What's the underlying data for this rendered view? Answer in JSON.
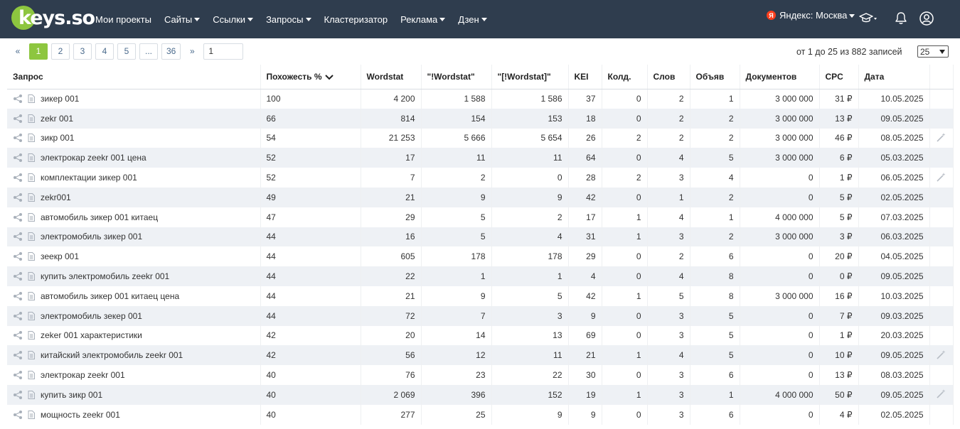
{
  "nav": {
    "logo": "keys.so",
    "items": [
      {
        "label": "Мои проекты",
        "dropdown": false
      },
      {
        "label": "Сайты",
        "dropdown": true
      },
      {
        "label": "Ссылки",
        "dropdown": true
      },
      {
        "label": "Запросы",
        "dropdown": true
      },
      {
        "label": "Кластеризатор",
        "dropdown": false
      },
      {
        "label": "Реклама",
        "dropdown": true
      },
      {
        "label": "Дзен",
        "dropdown": true
      }
    ],
    "region_badge": "Я",
    "region": "Яндекс: Москва"
  },
  "pagination": {
    "prev": "«",
    "pages": [
      "1",
      "2",
      "3",
      "4",
      "5",
      "...",
      "36"
    ],
    "active_page": "1",
    "next": "»",
    "goto_value": "1"
  },
  "records_info": "от 1 до 25 из 882 записей",
  "per_page": "25",
  "colors": {
    "header_bg": "#2f3d4e",
    "accent": "#8dc63f",
    "row_alt": "#eef1f5"
  },
  "table": {
    "columns": [
      "Запрос",
      "Похожесть %",
      "Wordstat",
      "\"!Wordstat\"",
      "\"[!Wordstat]\"",
      "KEI",
      "Колд.",
      "Слов",
      "Объяв",
      "Документов",
      "CPC",
      "Дата"
    ],
    "sorted_column": "Похожесть %",
    "rows": [
      {
        "query": "зикер 001",
        "sim": "100",
        "ws": "4 200",
        "ws_excl": "1 588",
        "ws_exact": "1 586",
        "kei": "37",
        "kold": "0",
        "words": "2",
        "ads": "1",
        "docs": "3 000 000",
        "cpc": "31 ₽",
        "date": "10.05.2025",
        "wand": false
      },
      {
        "query": "zekr 001",
        "sim": "66",
        "ws": "814",
        "ws_excl": "154",
        "ws_exact": "153",
        "kei": "18",
        "kold": "0",
        "words": "2",
        "ads": "2",
        "docs": "3 000 000",
        "cpc": "13 ₽",
        "date": "09.05.2025",
        "wand": false
      },
      {
        "query": "зикр 001",
        "sim": "54",
        "ws": "21 253",
        "ws_excl": "5 666",
        "ws_exact": "5 654",
        "kei": "26",
        "kold": "2",
        "words": "2",
        "ads": "2",
        "docs": "3 000 000",
        "cpc": "46 ₽",
        "date": "08.05.2025",
        "wand": true
      },
      {
        "query": "электрокар zeekr 001 цена",
        "sim": "52",
        "ws": "17",
        "ws_excl": "11",
        "ws_exact": "11",
        "kei": "64",
        "kold": "0",
        "words": "4",
        "ads": "5",
        "docs": "3 000 000",
        "cpc": "6 ₽",
        "date": "05.03.2025",
        "wand": false
      },
      {
        "query": "комплектации зикер 001",
        "sim": "52",
        "ws": "7",
        "ws_excl": "2",
        "ws_exact": "0",
        "kei": "28",
        "kold": "2",
        "words": "3",
        "ads": "4",
        "docs": "0",
        "cpc": "1 ₽",
        "date": "06.05.2025",
        "wand": true
      },
      {
        "query": "zekr001",
        "sim": "49",
        "ws": "21",
        "ws_excl": "9",
        "ws_exact": "9",
        "kei": "42",
        "kold": "0",
        "words": "1",
        "ads": "2",
        "docs": "0",
        "cpc": "5 ₽",
        "date": "02.05.2025",
        "wand": false
      },
      {
        "query": "автомобиль зикер 001 китаец",
        "sim": "47",
        "ws": "29",
        "ws_excl": "5",
        "ws_exact": "2",
        "kei": "17",
        "kold": "1",
        "words": "4",
        "ads": "1",
        "docs": "4 000 000",
        "cpc": "5 ₽",
        "date": "07.03.2025",
        "wand": false
      },
      {
        "query": "электромобиль зикер 001",
        "sim": "44",
        "ws": "16",
        "ws_excl": "5",
        "ws_exact": "4",
        "kei": "31",
        "kold": "1",
        "words": "3",
        "ads": "2",
        "docs": "3 000 000",
        "cpc": "3 ₽",
        "date": "06.03.2025",
        "wand": false
      },
      {
        "query": "зеекр 001",
        "sim": "44",
        "ws": "605",
        "ws_excl": "178",
        "ws_exact": "178",
        "kei": "29",
        "kold": "0",
        "words": "2",
        "ads": "6",
        "docs": "0",
        "cpc": "20 ₽",
        "date": "04.05.2025",
        "wand": false
      },
      {
        "query": "купить электромобиль zeekr 001",
        "sim": "44",
        "ws": "22",
        "ws_excl": "1",
        "ws_exact": "1",
        "kei": "4",
        "kold": "0",
        "words": "4",
        "ads": "8",
        "docs": "0",
        "cpc": "0 ₽",
        "date": "09.05.2025",
        "wand": false
      },
      {
        "query": "автомобиль зикер 001 китаец цена",
        "sim": "44",
        "ws": "21",
        "ws_excl": "9",
        "ws_exact": "5",
        "kei": "42",
        "kold": "1",
        "words": "5",
        "ads": "8",
        "docs": "3 000 000",
        "cpc": "16 ₽",
        "date": "10.03.2025",
        "wand": false
      },
      {
        "query": "электромобиль зекер 001",
        "sim": "44",
        "ws": "72",
        "ws_excl": "7",
        "ws_exact": "3",
        "kei": "9",
        "kold": "0",
        "words": "3",
        "ads": "5",
        "docs": "0",
        "cpc": "7 ₽",
        "date": "09.03.2025",
        "wand": false
      },
      {
        "query": "zeker 001 характеристики",
        "sim": "42",
        "ws": "20",
        "ws_excl": "14",
        "ws_exact": "13",
        "kei": "69",
        "kold": "0",
        "words": "3",
        "ads": "5",
        "docs": "0",
        "cpc": "1 ₽",
        "date": "20.03.2025",
        "wand": false
      },
      {
        "query": "китайский электромобиль zeekr 001",
        "sim": "42",
        "ws": "56",
        "ws_excl": "12",
        "ws_exact": "11",
        "kei": "21",
        "kold": "1",
        "words": "4",
        "ads": "5",
        "docs": "0",
        "cpc": "10 ₽",
        "date": "09.05.2025",
        "wand": true
      },
      {
        "query": "электрокар zeekr 001",
        "sim": "40",
        "ws": "76",
        "ws_excl": "23",
        "ws_exact": "22",
        "kei": "30",
        "kold": "0",
        "words": "3",
        "ads": "6",
        "docs": "0",
        "cpc": "13 ₽",
        "date": "08.03.2025",
        "wand": false
      },
      {
        "query": "купить зикр 001",
        "sim": "40",
        "ws": "2 069",
        "ws_excl": "396",
        "ws_exact": "152",
        "kei": "19",
        "kold": "1",
        "words": "3",
        "ads": "1",
        "docs": "4 000 000",
        "cpc": "50 ₽",
        "date": "09.05.2025",
        "wand": true
      },
      {
        "query": "мощность zeekr 001",
        "sim": "40",
        "ws": "277",
        "ws_excl": "25",
        "ws_exact": "9",
        "kei": "9",
        "kold": "0",
        "words": "3",
        "ads": "6",
        "docs": "0",
        "cpc": "4 ₽",
        "date": "02.05.2025",
        "wand": false
      }
    ]
  }
}
